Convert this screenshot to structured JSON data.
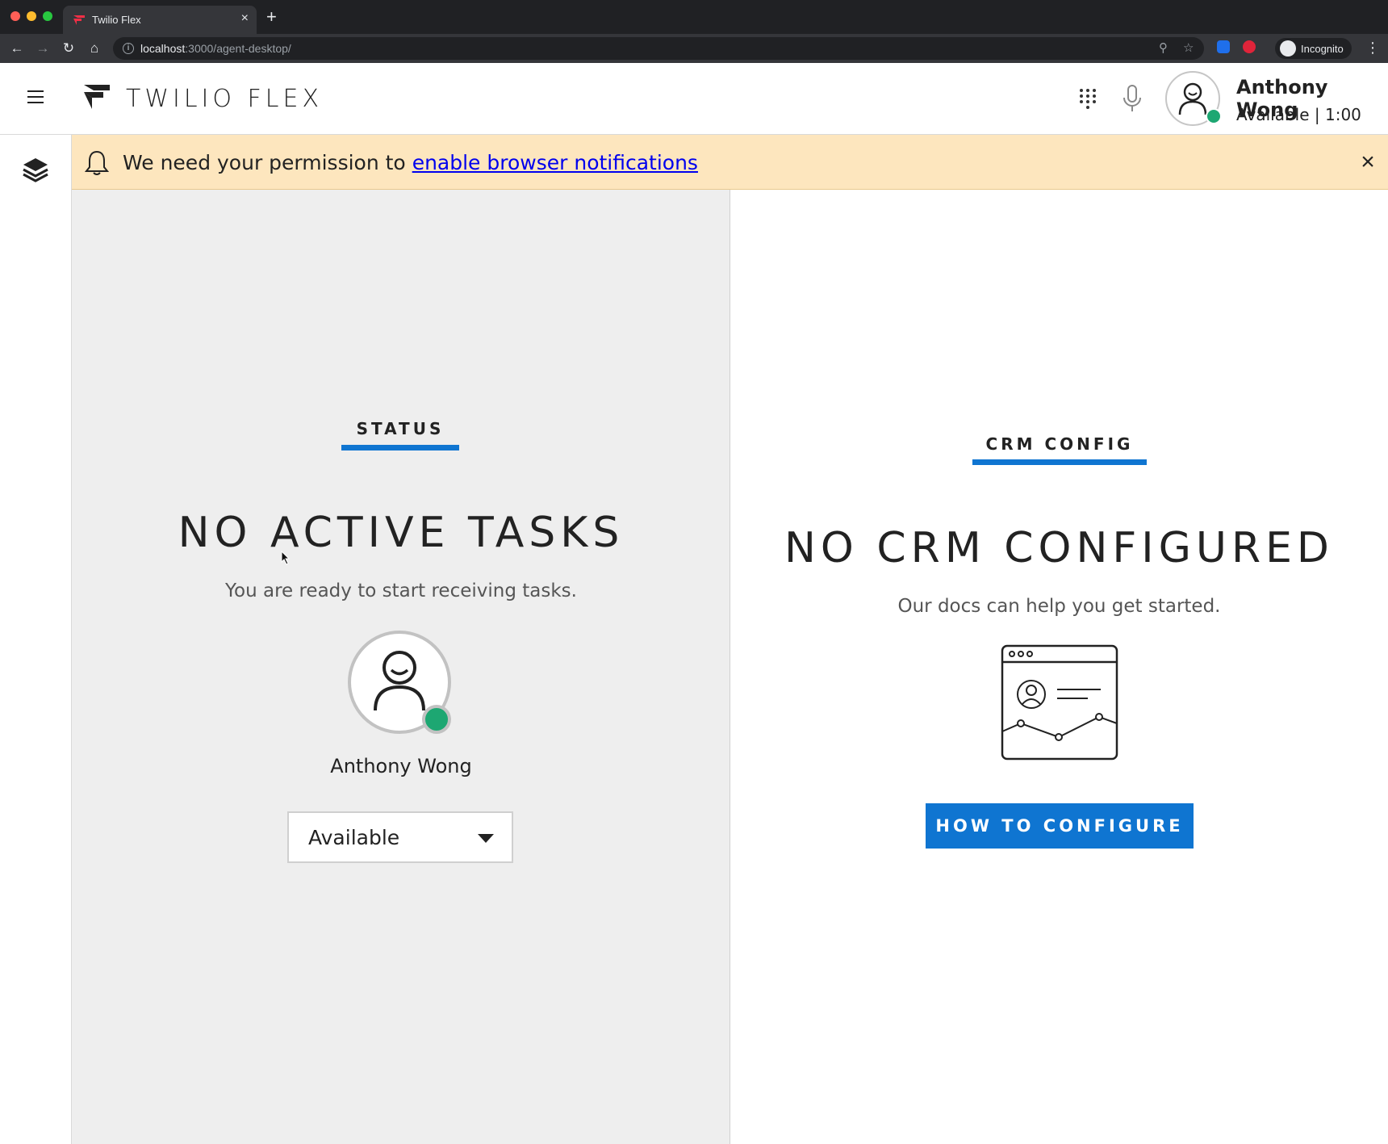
{
  "browser": {
    "tab_title": "Twilio Flex",
    "tab_close": "×",
    "new_tab": "+",
    "url_host": "localhost",
    "url_path": ":3000/agent-desktop/",
    "incognito_label": "Incognito"
  },
  "header": {
    "brand": "TWILIO FLEX",
    "user_name": "Anthony Wong",
    "user_status": "Available | 1:00"
  },
  "banner": {
    "text": "We need your permission to ",
    "link": "enable browser notifications",
    "close": "×"
  },
  "status_panel": {
    "tab_label": "STATUS",
    "title": "NO ACTIVE TASKS",
    "subtitle": "You are ready to start receiving tasks.",
    "agent_name": "Anthony Wong",
    "activity_selected": "Available"
  },
  "crm_panel": {
    "tab_label": "CRM CONFIG",
    "title": "NO CRM CONFIGURED",
    "subtitle": "Our docs can help you get started.",
    "button_label": "HOW TO CONFIGURE"
  },
  "colors": {
    "accent": "#0f75d1",
    "available": "#1da772",
    "banner_bg": "#fde6be",
    "left_panel_bg": "#eeeeee"
  }
}
